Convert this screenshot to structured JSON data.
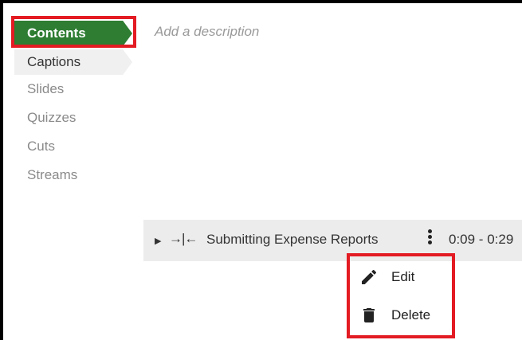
{
  "sidebar": {
    "items": [
      {
        "label": "Contents",
        "state": "active"
      },
      {
        "label": "Captions",
        "state": "secondary"
      },
      {
        "label": "Slides",
        "state": "normal"
      },
      {
        "label": "Quizzes",
        "state": "normal"
      },
      {
        "label": "Cuts",
        "state": "normal"
      },
      {
        "label": "Streams",
        "state": "normal"
      }
    ]
  },
  "main": {
    "description_placeholder": "Add a description"
  },
  "chapter": {
    "title": "Submitting Expense Reports",
    "time_range": "0:09 - 0:29",
    "split_glyph": "→|←"
  },
  "context_menu": {
    "items": [
      {
        "label": "Edit",
        "icon": "pencil-icon"
      },
      {
        "label": "Delete",
        "icon": "trash-icon"
      }
    ]
  },
  "colors": {
    "accent": "#2e7d32",
    "highlight": "#e31b23"
  }
}
